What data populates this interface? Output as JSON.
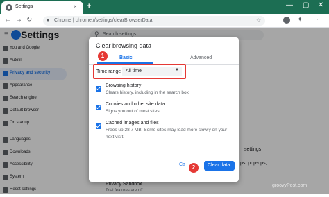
{
  "browser": {
    "tab_title": "Settings",
    "tab_close": "×",
    "new_tab": "+",
    "window_controls": [
      "—",
      "▢",
      "✕"
    ],
    "address": "Chrome | chrome://settings/clearBrowserData",
    "icons": [
      "back-arrow-icon",
      "forward-arrow-icon",
      "reload-icon",
      "lock-icon",
      "star-icon",
      "kebab-menu-icon"
    ]
  },
  "settings": {
    "title": "Settings",
    "search_placeholder": "Search settings",
    "sidebar": [
      {
        "label": "You and Google"
      },
      {
        "label": "Autofill"
      },
      {
        "label": "Privacy and security",
        "active": true
      },
      {
        "label": "Appearance"
      },
      {
        "label": "Search engine"
      },
      {
        "label": "Default browser"
      },
      {
        "label": "On startup"
      },
      {
        "label": "Languages"
      },
      {
        "label": "Downloads"
      },
      {
        "label": "Accessibility"
      },
      {
        "label": "System"
      },
      {
        "label": "Reset settings"
      }
    ],
    "peek": {
      "right_text": "settings",
      "popups_text": "ps, pop-ups,",
      "privacy_sandbox": "Privacy Sandbox",
      "trial_text": "Trial features are off"
    }
  },
  "dialog": {
    "title": "Clear browsing data",
    "tabs": [
      "Basic",
      "Advanced"
    ],
    "time_range_label": "Time range",
    "time_range_value": "All time",
    "options": [
      {
        "title": "Browsing history",
        "desc": [
          "Clears history, including in the search box"
        ],
        "checked": true
      },
      {
        "title": "Cookies and other site data",
        "desc": [
          "Signs you out of most sites."
        ],
        "checked": true
      },
      {
        "title": "Cached images and files",
        "desc": [
          "Frees up 28.7 MB. Some sites may load more slowly on your",
          "next visit."
        ],
        "checked": true
      }
    ],
    "cancel_label": "Ca",
    "clear_label": "Clear data"
  },
  "annotations": {
    "marker1": "1",
    "marker2": "2",
    "color": "#e53935"
  },
  "watermark": "groovyPost.com",
  "colors": {
    "frame": "#1c6e53",
    "accent": "#1a73e8",
    "annotation": "#e53935"
  }
}
